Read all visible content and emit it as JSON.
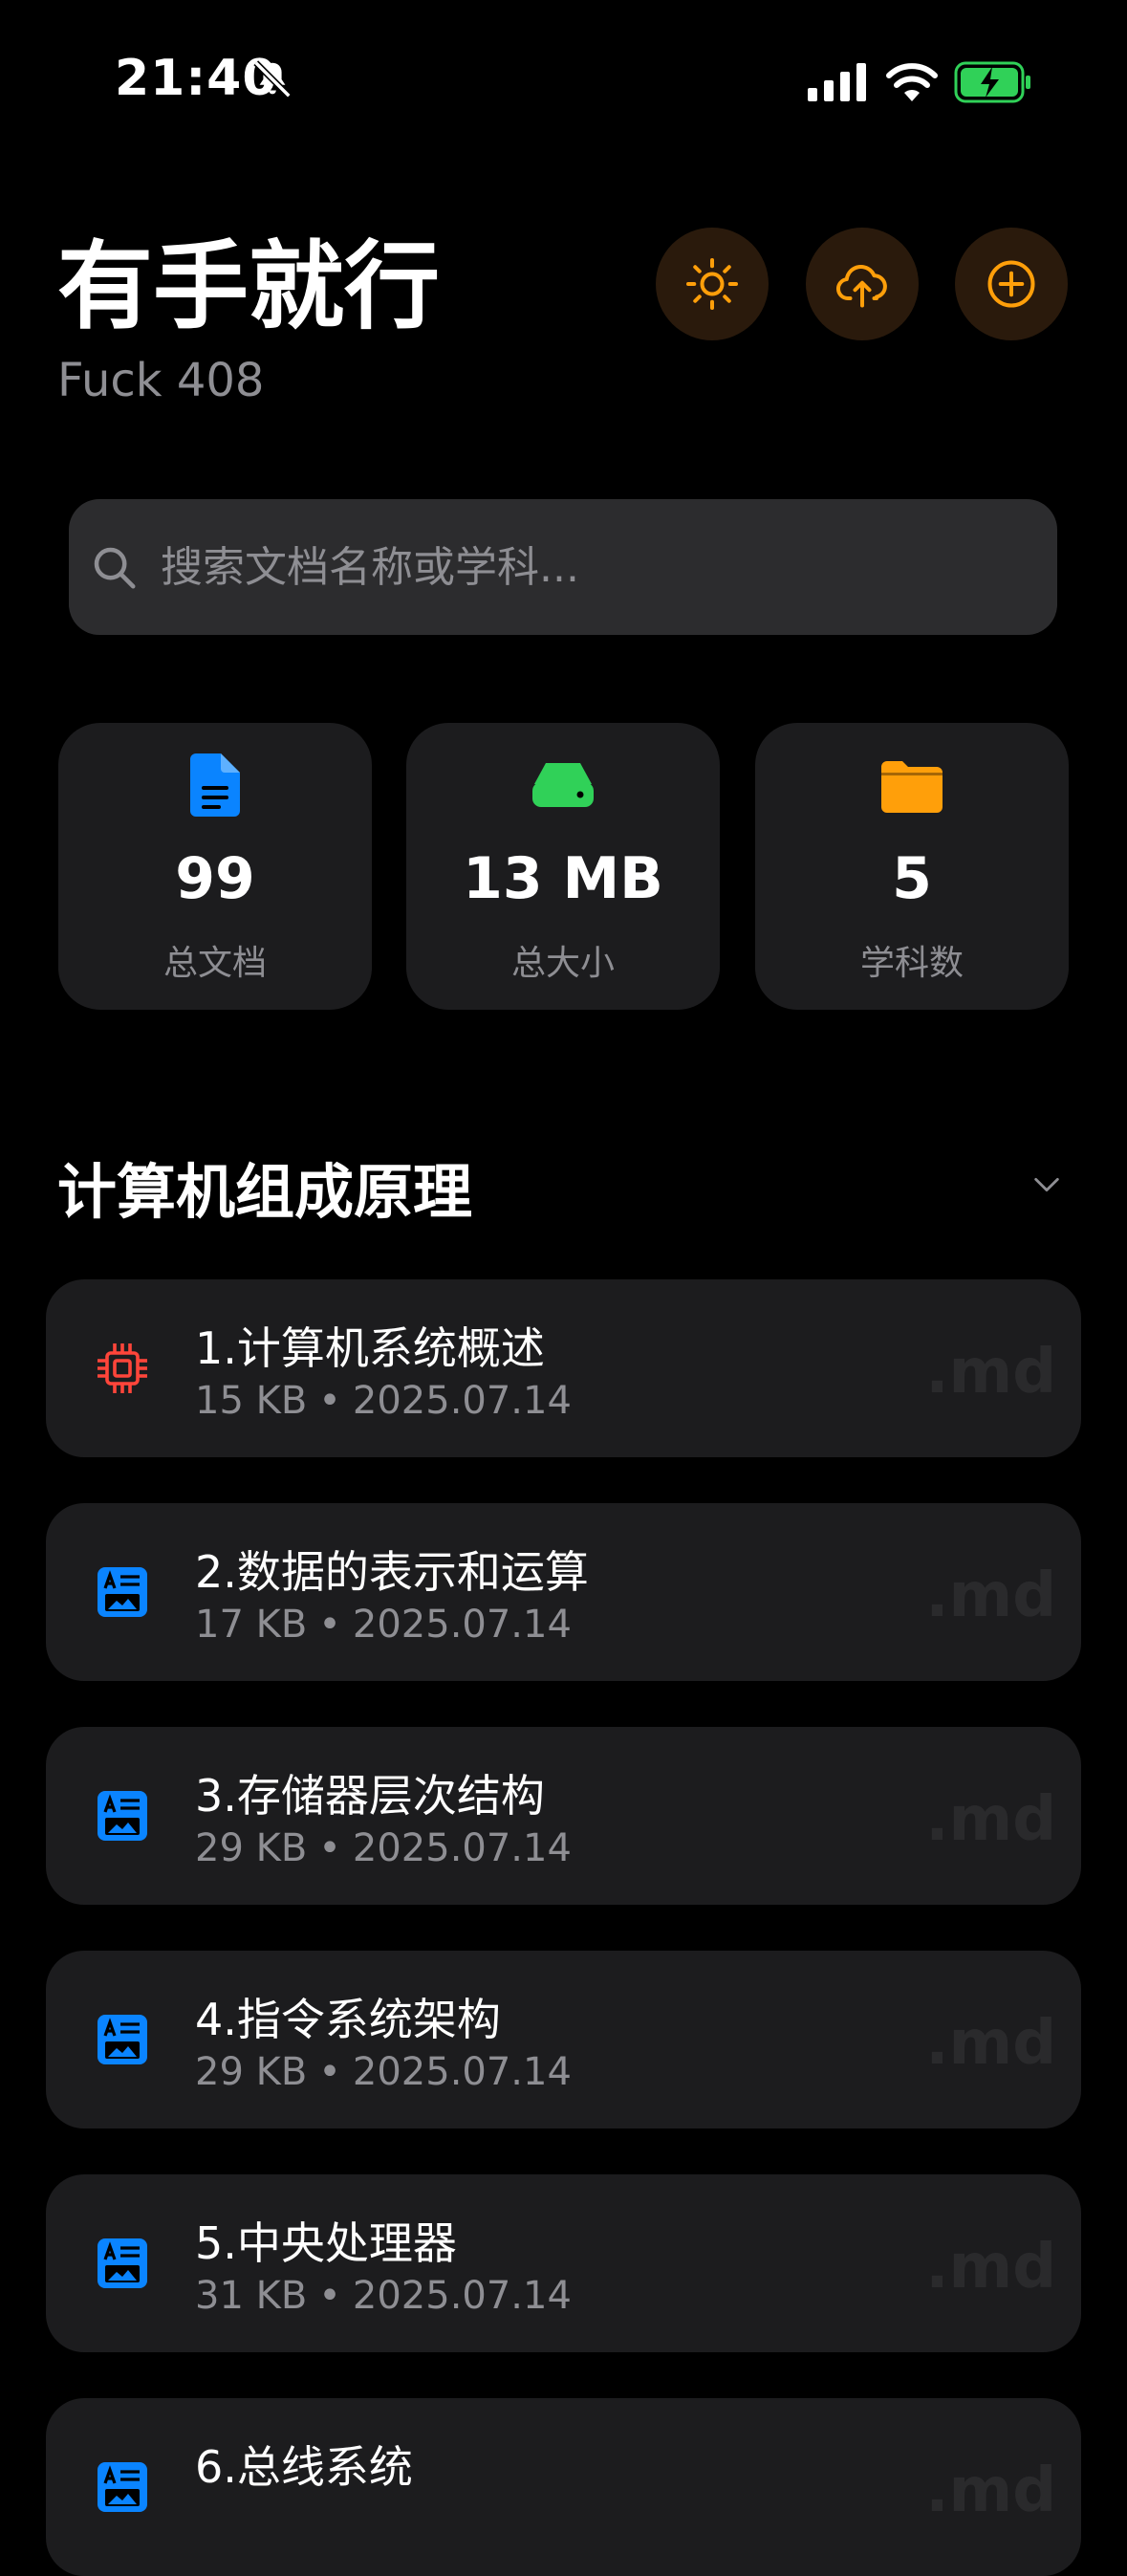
{
  "status_bar": {
    "time": "21:40",
    "bell_icon": "bell-slash-icon",
    "signal_icon": "cellular-signal-icon",
    "wifi_icon": "wifi-icon",
    "battery_icon": "battery-charging-icon",
    "battery_color": "#30d158"
  },
  "header": {
    "title": "有手就行",
    "subtitle": "Fuck 408",
    "accent_color": "#ff9f0a",
    "buttons": [
      {
        "icon": "sun-icon"
      },
      {
        "icon": "cloud-upload-icon"
      },
      {
        "icon": "plus-circle-icon"
      }
    ]
  },
  "search": {
    "placeholder": "搜索文档名称或学科...",
    "value": ""
  },
  "stats": [
    {
      "icon": "document-icon",
      "value": "99",
      "label": "总文档",
      "color": "#0a84ff"
    },
    {
      "icon": "drive-icon",
      "value": "13 MB",
      "label": "总大小",
      "color": "#30d158"
    },
    {
      "icon": "folder-icon",
      "value": "5",
      "label": "学科数",
      "color": "#ff9f0a"
    }
  ],
  "section": {
    "title": "计算机组成原理",
    "chevron": "chevron-down-icon"
  },
  "documents": [
    {
      "title": "1.计算机系统概述",
      "size": "15 KB",
      "date": "2025.07.14",
      "ext": ".md",
      "icon": "cpu-chip-icon",
      "icon_color": "#ff453a"
    },
    {
      "title": "2.数据的表示和运算",
      "size": "17 KB",
      "date": "2025.07.14",
      "ext": ".md",
      "icon": "text-image-icon",
      "icon_color": "#0a84ff"
    },
    {
      "title": "3.存储器层次结构",
      "size": "29 KB",
      "date": "2025.07.14",
      "ext": ".md",
      "icon": "text-image-icon",
      "icon_color": "#0a84ff"
    },
    {
      "title": "4.指令系统架构",
      "size": "29 KB",
      "date": "2025.07.14",
      "ext": ".md",
      "icon": "text-image-icon",
      "icon_color": "#0a84ff"
    },
    {
      "title": "5.中央处理器",
      "size": "31 KB",
      "date": "2025.07.14",
      "ext": ".md",
      "icon": "text-image-icon",
      "icon_color": "#0a84ff"
    },
    {
      "title": "6.总线系统",
      "size": "",
      "date": "",
      "ext": ".md",
      "icon": "text-image-icon",
      "icon_color": "#0a84ff"
    }
  ],
  "meta_separator": "•"
}
